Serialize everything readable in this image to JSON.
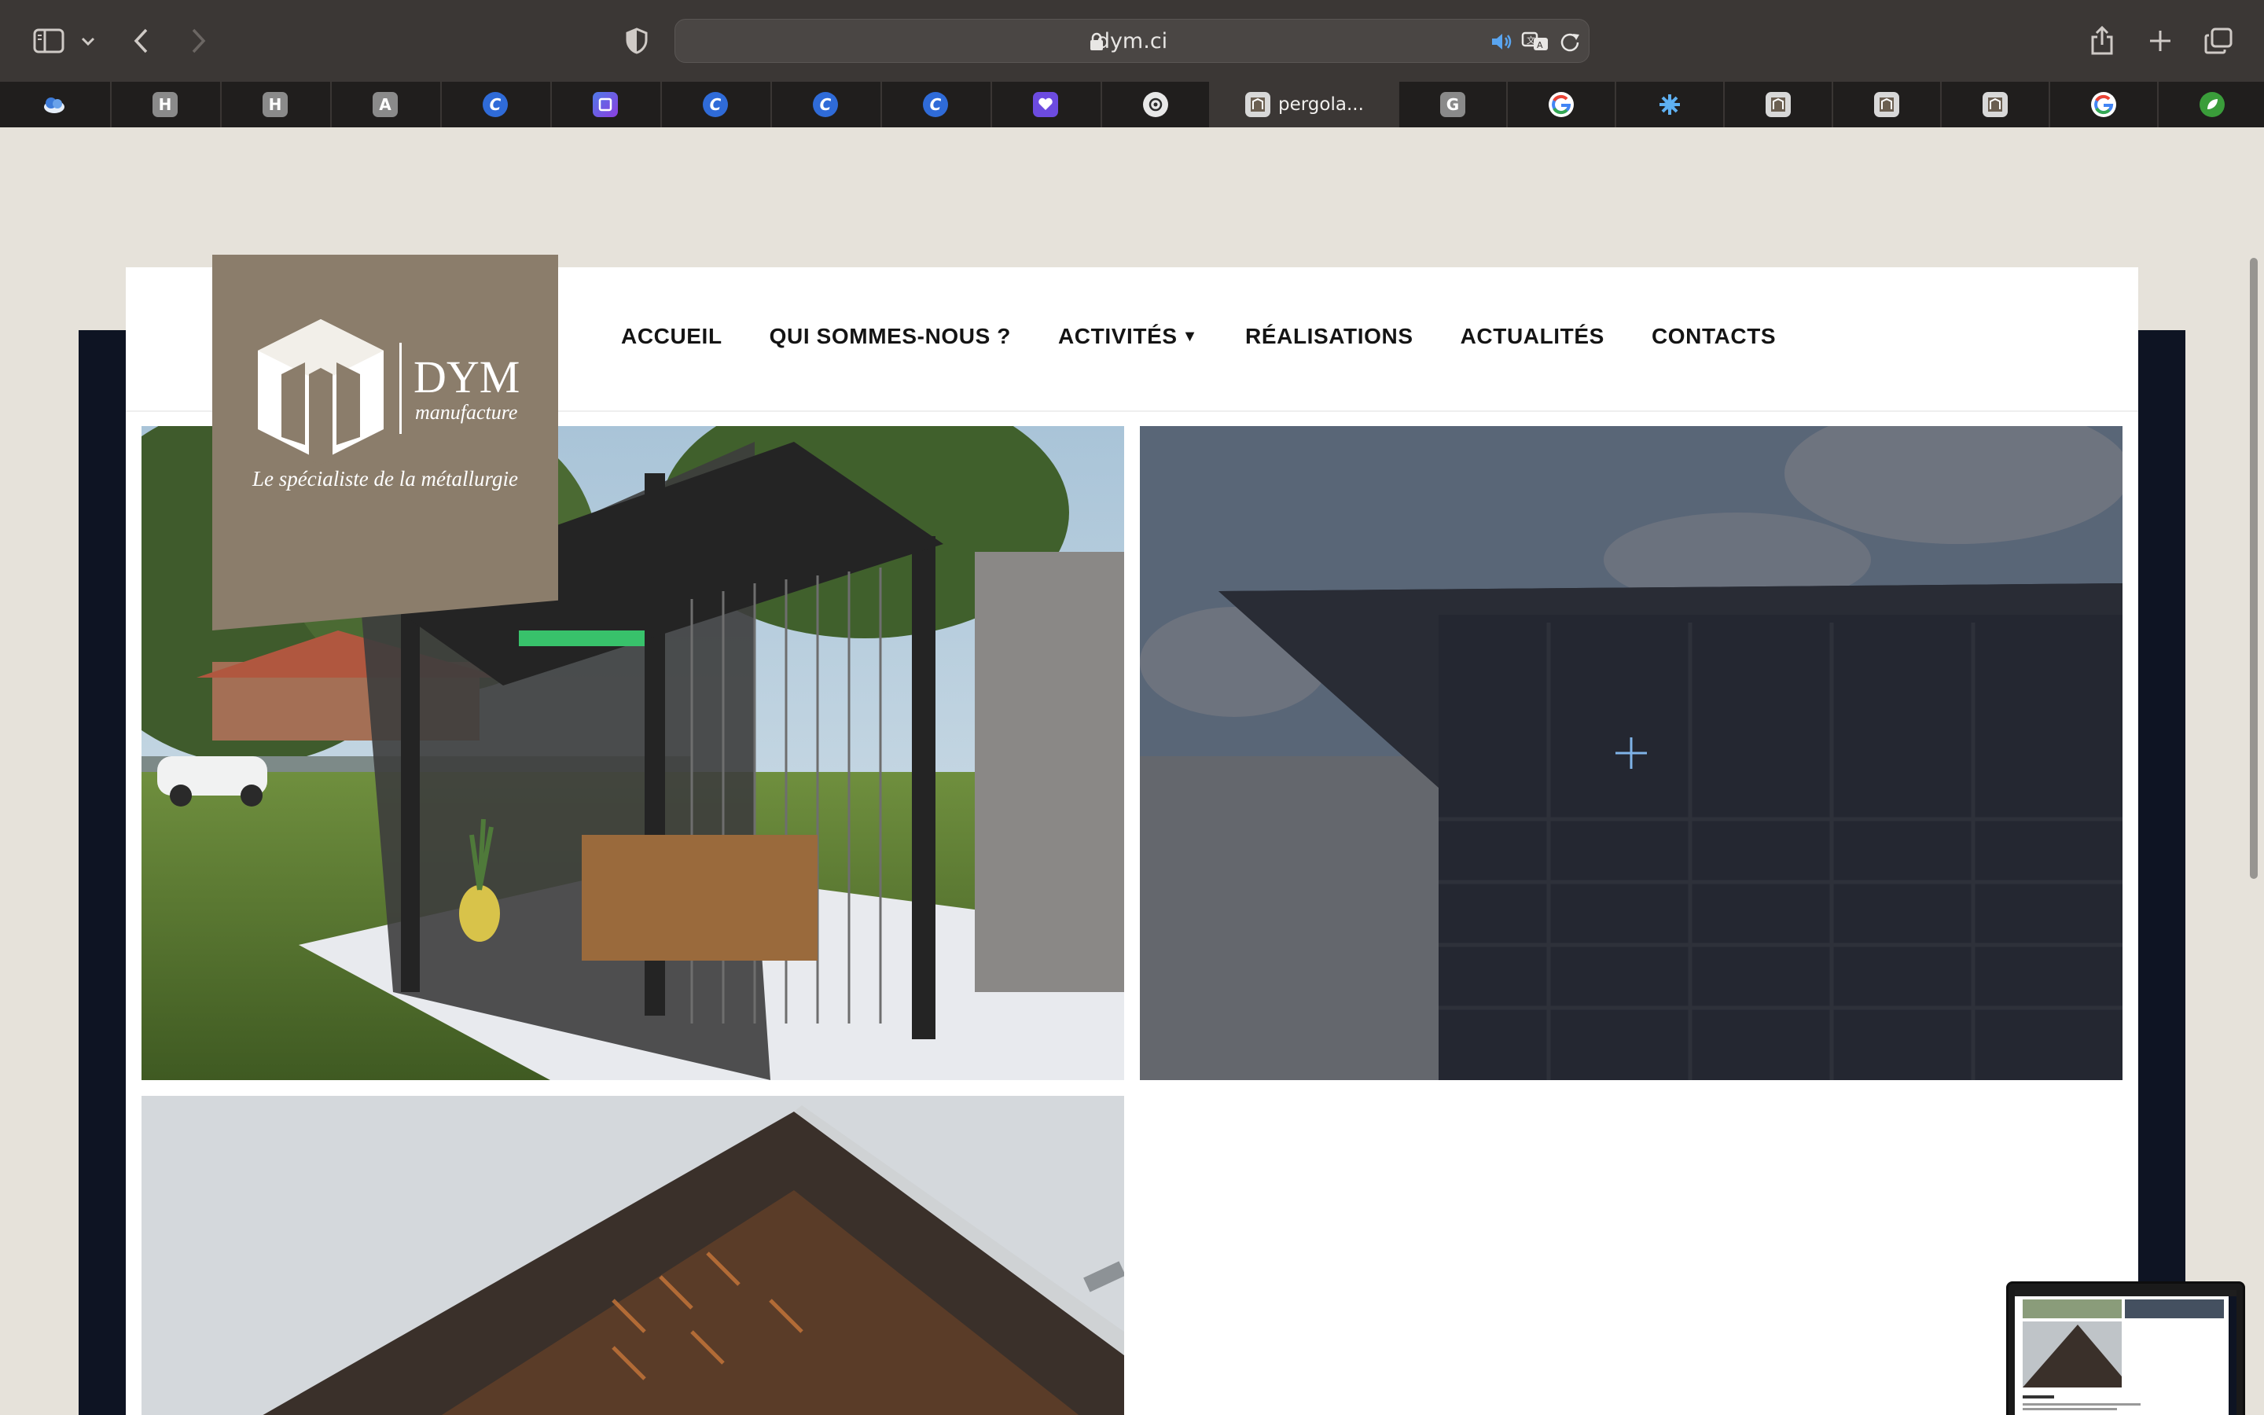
{
  "browser": {
    "url": "dym.ci",
    "active_tab_title": "pergola...",
    "tabs": [
      {
        "icon": "cloud-icon",
        "letter": "",
        "color": "#3d7bd9"
      },
      {
        "icon": "h-favicon",
        "letter": "H",
        "color": "#8a8a8a"
      },
      {
        "icon": "h-favicon",
        "letter": "H",
        "color": "#8a8a8a"
      },
      {
        "icon": "a-favicon",
        "letter": "A",
        "color": "#8a8a8a"
      },
      {
        "icon": "c-favicon",
        "letter": "C",
        "color": "#2f6bd8"
      },
      {
        "icon": "screen-icon",
        "letter": "",
        "color": "#5b46d6"
      },
      {
        "icon": "c-favicon",
        "letter": "C",
        "color": "#2f6bd8"
      },
      {
        "icon": "c-favicon",
        "letter": "C",
        "color": "#2f6bd8"
      },
      {
        "icon": "c-favicon",
        "letter": "C",
        "color": "#2f6bd8"
      },
      {
        "icon": "heart-icon",
        "letter": "",
        "color": "#6c4be0"
      },
      {
        "icon": "openai-icon",
        "letter": "",
        "color": "#5a5a5a"
      },
      {
        "icon": "dym-favicon",
        "letter": "",
        "color": "#d8d8d8"
      },
      {
        "icon": "g-favicon",
        "letter": "G",
        "color": "#8a8a8a"
      },
      {
        "icon": "google-icon",
        "letter": "",
        "color": "#ffffff"
      },
      {
        "icon": "gear-flower-icon",
        "letter": "",
        "color": "#2a7bd8"
      },
      {
        "icon": "dym-favicon",
        "letter": "",
        "color": "#d8d8d8"
      },
      {
        "icon": "dym-favicon",
        "letter": "",
        "color": "#d8d8d8"
      },
      {
        "icon": "dym-favicon",
        "letter": "",
        "color": "#d8d8d8"
      },
      {
        "icon": "google-icon",
        "letter": "",
        "color": "#ffffff"
      },
      {
        "icon": "leaf-icon",
        "letter": "",
        "color": "#3a9d3a"
      }
    ]
  },
  "site": {
    "logo": {
      "name": "DYM",
      "subtitle": "manufacture",
      "tagline": "Le spécialiste de la métallurgie"
    },
    "nav": [
      {
        "label": "ACCUEIL"
      },
      {
        "label": "QUI SOMMES-NOUS ?"
      },
      {
        "label": "ACTIVITÉS",
        "has_dropdown": true
      },
      {
        "label": "RÉALISATIONS"
      },
      {
        "label": "ACTUALITÉS"
      },
      {
        "label": "CONTACTS"
      }
    ]
  },
  "colors": {
    "logo_bg": "#8b7d6b",
    "frame": "#0e1423",
    "page_bg": "#e6e2da"
  }
}
